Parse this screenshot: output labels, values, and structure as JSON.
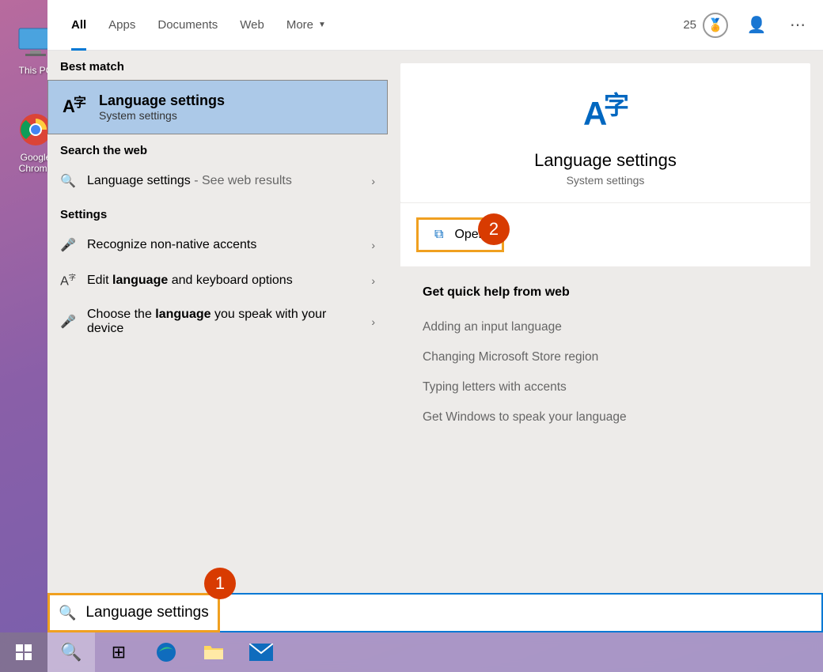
{
  "desktop": {
    "icons": [
      {
        "label": "This PC"
      },
      {
        "label": "Google Chrome"
      }
    ]
  },
  "tabs": {
    "items": [
      "All",
      "Apps",
      "Documents",
      "Web",
      "More"
    ],
    "active_index": 0
  },
  "rewards": {
    "points": "25"
  },
  "left": {
    "best_match_label": "Best match",
    "best_match": {
      "title": "Language settings",
      "subtitle": "System settings"
    },
    "web_label": "Search the web",
    "web_item": {
      "query": "Language settings",
      "suffix": " - See web results"
    },
    "settings_label": "Settings",
    "settings_items": [
      {
        "pre": "Recognize non-native accents",
        "hl": "",
        "post": ""
      },
      {
        "pre": "Edit ",
        "hl": "language",
        "post": " and keyboard options"
      },
      {
        "pre": "Choose the ",
        "hl": "language",
        "post": " you speak with your device"
      }
    ]
  },
  "right": {
    "title": "Language settings",
    "subtitle": "System settings",
    "open_label": "Open",
    "help_title": "Get quick help from web",
    "help_links": [
      "Adding an input language",
      "Changing Microsoft Store region",
      "Typing letters with accents",
      "Get Windows to speak your language"
    ]
  },
  "search": {
    "value": "Language settings"
  },
  "annotations": {
    "a1": "1",
    "a2": "2"
  }
}
